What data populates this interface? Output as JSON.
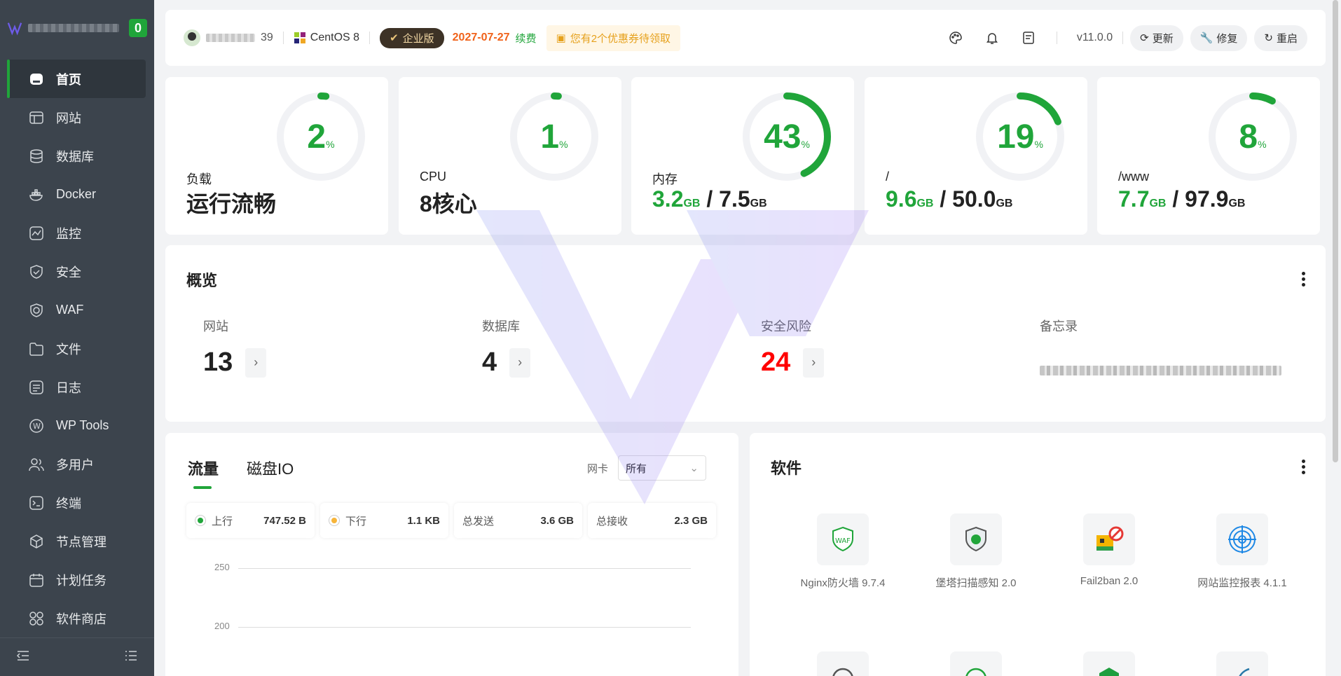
{
  "brand": {
    "notify_count": "0"
  },
  "sidebar": {
    "items": [
      {
        "label": "首页",
        "icon": "home-icon"
      },
      {
        "label": "网站",
        "icon": "website-icon"
      },
      {
        "label": "数据库",
        "icon": "database-icon"
      },
      {
        "label": "Docker",
        "icon": "docker-icon"
      },
      {
        "label": "监控",
        "icon": "monitor-icon"
      },
      {
        "label": "安全",
        "icon": "shield-icon"
      },
      {
        "label": "WAF",
        "icon": "waf-icon"
      },
      {
        "label": "文件",
        "icon": "folder-icon"
      },
      {
        "label": "日志",
        "icon": "log-icon"
      },
      {
        "label": "WP Tools",
        "icon": "wordpress-icon"
      },
      {
        "label": "多用户",
        "icon": "users-icon"
      },
      {
        "label": "终端",
        "icon": "terminal-icon"
      },
      {
        "label": "节点管理",
        "icon": "node-icon"
      },
      {
        "label": "计划任务",
        "icon": "calendar-icon"
      },
      {
        "label": "软件商店",
        "icon": "store-icon"
      }
    ]
  },
  "header": {
    "user_suffix": "39",
    "os": "CentOS 8",
    "edition": "企业版",
    "expire_date": "2027-07-27",
    "renew": "续费",
    "coupon": "您有2个优惠券待领取",
    "version": "v11.0.0",
    "update": "更新",
    "repair": "修复",
    "restart": "重启"
  },
  "stats": {
    "load": {
      "percent": "2",
      "label": "负载",
      "value": "运行流畅"
    },
    "cpu": {
      "percent": "1",
      "label": "CPU",
      "value": "8核心"
    },
    "memory": {
      "percent": "43",
      "label": "内存",
      "used": "3.2",
      "total": "7.5",
      "unit": "GB"
    },
    "disk_root": {
      "percent": "19",
      "label": "/",
      "used": "9.6",
      "total": "50.0",
      "unit": "GB"
    },
    "disk_www": {
      "percent": "8",
      "label": "/www",
      "used": "7.7",
      "total": "97.9",
      "unit": "GB"
    }
  },
  "overview": {
    "title": "概览",
    "sites": {
      "label": "网站",
      "value": "13"
    },
    "databases": {
      "label": "数据库",
      "value": "4"
    },
    "risks": {
      "label": "安全风险",
      "value": "24"
    },
    "memo": {
      "label": "备忘录"
    }
  },
  "traffic": {
    "tab_traffic": "流量",
    "tab_disk": "磁盘IO",
    "nic_label": "网卡",
    "nic_value": "所有",
    "upload_label": "上行",
    "upload": "747.52 B",
    "download_label": "下行",
    "download": "1.1 KB",
    "sent_label": "总发送",
    "sent": "3.6 GB",
    "recv_label": "总接收",
    "recv": "2.3 GB",
    "y_ticks": [
      "250",
      "200"
    ]
  },
  "software": {
    "title": "软件",
    "items": [
      {
        "name": "Nginx防火墙 9.7.4"
      },
      {
        "name": "堡塔扫描感知 2.0"
      },
      {
        "name": "Fail2ban 2.0"
      },
      {
        "name": "网站监控报表 4.1.1"
      }
    ]
  },
  "colors": {
    "accent": "#20a53a",
    "sidebar": "#3c444d",
    "danger": "#ff0000",
    "warning": "#f0621a"
  }
}
